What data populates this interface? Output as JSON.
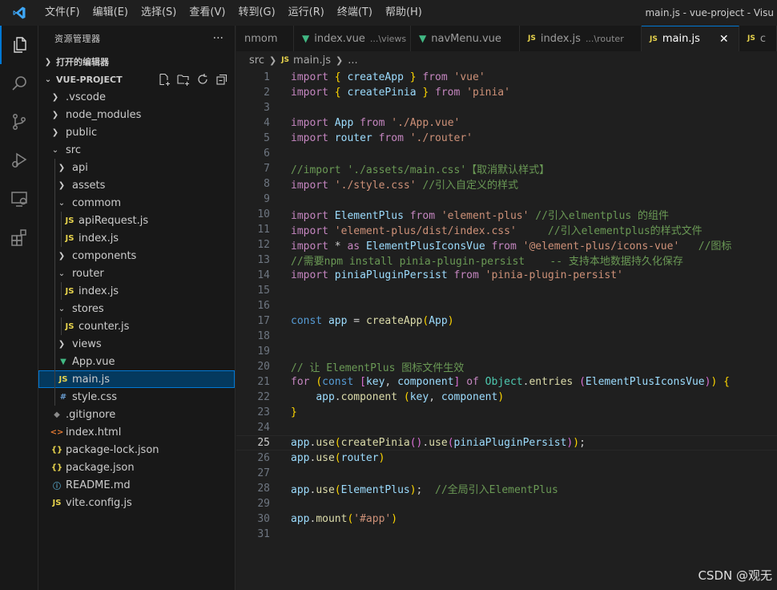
{
  "titlebar": {
    "menu": [
      "文件(F)",
      "编辑(E)",
      "选择(S)",
      "查看(V)",
      "转到(G)",
      "运行(R)",
      "终端(T)",
      "帮助(H)"
    ],
    "window_title": "main.js - vue-project - Visu"
  },
  "activity_bar": [
    "explorer-icon",
    "search-icon",
    "source-control-icon",
    "run-debug-icon",
    "remote-explorer-icon",
    "extensions-icon"
  ],
  "sidebar": {
    "title": "资源管理器",
    "more": "···",
    "open_editors": "打开的编辑器",
    "project": "VUE-PROJECT",
    "tree": [
      {
        "label": ".vscode",
        "type": "folder",
        "open": false
      },
      {
        "label": "node_modules",
        "type": "folder",
        "open": false
      },
      {
        "label": "public",
        "type": "folder",
        "open": false
      },
      {
        "label": "src",
        "type": "folder",
        "open": true
      },
      {
        "label": "api",
        "type": "folder",
        "open": false
      },
      {
        "label": "assets",
        "type": "folder",
        "open": false
      },
      {
        "label": "commom",
        "type": "folder",
        "open": true
      },
      {
        "label": "apiRequest.js",
        "type": "js"
      },
      {
        "label": "index.js",
        "type": "js"
      },
      {
        "label": "components",
        "type": "folder",
        "open": false
      },
      {
        "label": "router",
        "type": "folder",
        "open": true
      },
      {
        "label": "index.js",
        "type": "js"
      },
      {
        "label": "stores",
        "type": "folder",
        "open": true
      },
      {
        "label": "counter.js",
        "type": "js"
      },
      {
        "label": "views",
        "type": "folder",
        "open": false
      },
      {
        "label": "App.vue",
        "type": "vue"
      },
      {
        "label": "main.js",
        "type": "js",
        "selected": true
      },
      {
        "label": "style.css",
        "type": "css"
      },
      {
        "label": ".gitignore",
        "type": "git"
      },
      {
        "label": "index.html",
        "type": "html"
      },
      {
        "label": "package-lock.json",
        "type": "json"
      },
      {
        "label": "package.json",
        "type": "json"
      },
      {
        "label": "README.md",
        "type": "info"
      },
      {
        "label": "vite.config.js",
        "type": "js"
      }
    ]
  },
  "tabs": [
    {
      "label": "nmom",
      "desc": "",
      "icon": ""
    },
    {
      "label": "index.vue",
      "desc": "...\\views",
      "icon": "vue"
    },
    {
      "label": "navMenu.vue",
      "desc": "",
      "icon": "vue"
    },
    {
      "label": "index.js",
      "desc": "...\\router",
      "icon": "js"
    },
    {
      "label": "main.js",
      "desc": "",
      "icon": "js",
      "active": true
    },
    {
      "label": "c",
      "desc": "",
      "icon": "js"
    }
  ],
  "breadcrumb": {
    "folder": "src",
    "file": "main.js",
    "more": "..."
  },
  "editor": {
    "current_line": 25,
    "lines": [
      "import { createApp } from 'vue'",
      "import { createPinia } from 'pinia'",
      "",
      "import App from './App.vue'",
      "import router from './router'",
      "",
      "//import './assets/main.css'【取消默认样式】",
      "import './style.css' //引入自定义的样式",
      "",
      "import ElementPlus from 'element-plus' //引入elmentplus 的组件",
      "import 'element-plus/dist/index.css'     //引入elementplus的样式文件",
      "import * as ElementPlusIconsVue from '@element-plus/icons-vue'   //图标",
      "//需要npm install pinia-plugin-persist    -- 支持本地数据持久化保存",
      "import piniaPluginPersist from 'pinia-plugin-persist'",
      "",
      "",
      "const app = createApp(App)",
      "",
      "",
      "// 让 ElementPlus 图标文件生效",
      "for (const [key, component] of Object.entries (ElementPlusIconsVue)) {",
      "    app.component (key, component)",
      "}",
      "",
      "app.use(createPinia().use(piniaPluginPersist));",
      "app.use(router)",
      "",
      "app.use(ElementPlus);  //全局引入ElementPlus",
      "",
      "app.mount('#app')",
      ""
    ]
  },
  "watermark": "CSDN @观无"
}
